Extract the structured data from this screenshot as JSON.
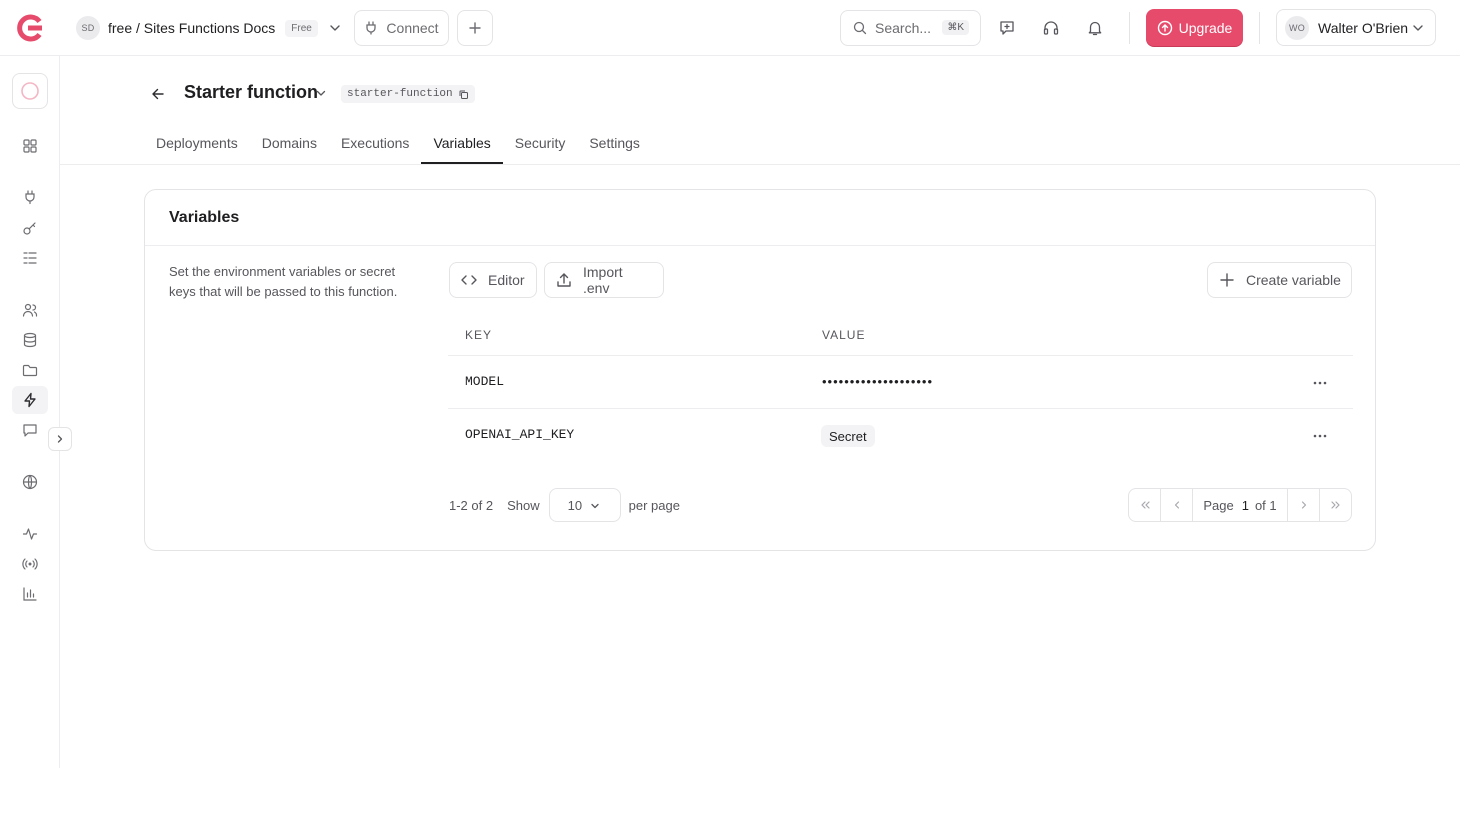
{
  "header": {
    "project": {
      "initials": "SD",
      "name": "free / Sites Functions Docs",
      "plan_badge": "Free"
    },
    "connect_label": "Connect",
    "search": {
      "placeholder": "Search...",
      "shortcut": "⌘K"
    },
    "upgrade_label": "Upgrade",
    "user": {
      "initials": "WO",
      "name": "Walter O'Brien"
    },
    "accent_color": "#e64b6b"
  },
  "sidebar": {
    "items": [
      {
        "icon": "dashboard-icon"
      },
      {
        "icon": "plug-icon"
      },
      {
        "icon": "key-icon"
      },
      {
        "icon": "list-icon"
      },
      {
        "icon": "users-icon"
      },
      {
        "icon": "database-icon"
      },
      {
        "icon": "folder-icon"
      },
      {
        "icon": "bolt-icon",
        "active": true
      },
      {
        "icon": "message-icon"
      },
      {
        "icon": "globe-icon"
      },
      {
        "icon": "activity-icon"
      },
      {
        "icon": "broadcast-icon"
      },
      {
        "icon": "bar-chart-icon"
      }
    ]
  },
  "page": {
    "title": "Starter function",
    "id_badge": "starter-function",
    "tabs": [
      {
        "label": "Deployments"
      },
      {
        "label": "Domains"
      },
      {
        "label": "Executions"
      },
      {
        "label": "Variables",
        "active": true
      },
      {
        "label": "Security"
      },
      {
        "label": "Settings"
      }
    ]
  },
  "variables_card": {
    "title": "Variables",
    "description": "Set the environment variables or secret keys that will be passed to this function.",
    "editor_label": "Editor",
    "import_label": "Import .env",
    "create_label": "Create variable",
    "columns": {
      "key": "KEY",
      "value": "VALUE"
    },
    "rows": [
      {
        "key": "MODEL",
        "value": "••••••••••••••••••••"
      },
      {
        "key": "OPENAI_API_KEY",
        "value": "Secret"
      }
    ],
    "pagination": {
      "range": "1-2 of 2",
      "show_label": "Show",
      "per_page_value": "10",
      "per_page_label": "per page",
      "page_label": "Page",
      "current_page": "1",
      "of_label": "of 1"
    }
  }
}
